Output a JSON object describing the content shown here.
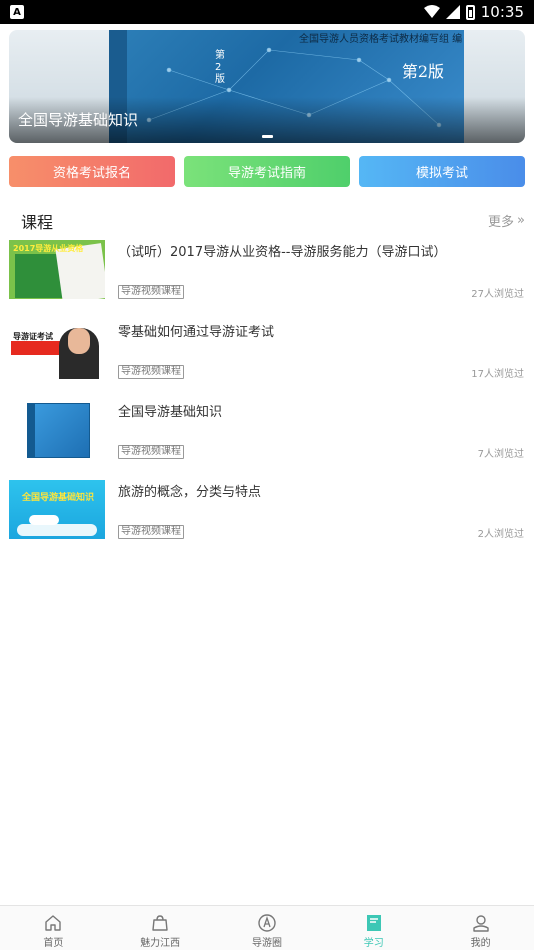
{
  "status_bar": {
    "time": "10:35",
    "notif_glyph": "A"
  },
  "banner": {
    "title": "全国导游基础知识",
    "edition": "第2版",
    "authors": "全国导游人员资格考试教材编写组 编",
    "spine_text": "第2版"
  },
  "actions": [
    {
      "label": "资格考试报名",
      "color": "#f47b6a"
    },
    {
      "label": "导游考试指南",
      "color": "#5fd670"
    },
    {
      "label": "模拟考试",
      "color": "#4e9bee"
    }
  ],
  "section": {
    "title": "课程",
    "more": "更多",
    "more_glyph": "»"
  },
  "courses": [
    {
      "title": "（试听）2017导游从业资格--导游服务能力（导游口试）",
      "tag": "导游视频课程",
      "views": "27人浏览过",
      "thumb_text": "2017导游从业资格"
    },
    {
      "title": "零基础如何通过导游证考试",
      "tag": "导游视频课程",
      "views": "17人浏览过",
      "thumb_text": "导游证考试"
    },
    {
      "title": "全国导游基础知识",
      "tag": "导游视频课程",
      "views": "7人浏览过",
      "thumb_text": ""
    },
    {
      "title": "旅游的概念，分类与特点",
      "tag": "导游视频课程",
      "views": "2人浏览过",
      "thumb_text": "全国导游基础知识"
    }
  ],
  "tabbar": [
    {
      "label": "首页",
      "icon": "home-icon",
      "active": false
    },
    {
      "label": "魅力江西",
      "icon": "bag-icon",
      "active": false
    },
    {
      "label": "导游圈",
      "icon": "compass-icon",
      "active": false
    },
    {
      "label": "学习",
      "icon": "book-icon",
      "active": true
    },
    {
      "label": "我的",
      "icon": "person-icon",
      "active": false
    }
  ],
  "colors": {
    "accent": "#3dc7b5",
    "red_button": "#f47b6a",
    "green_button": "#5fd670",
    "blue_button": "#4e9bee"
  }
}
